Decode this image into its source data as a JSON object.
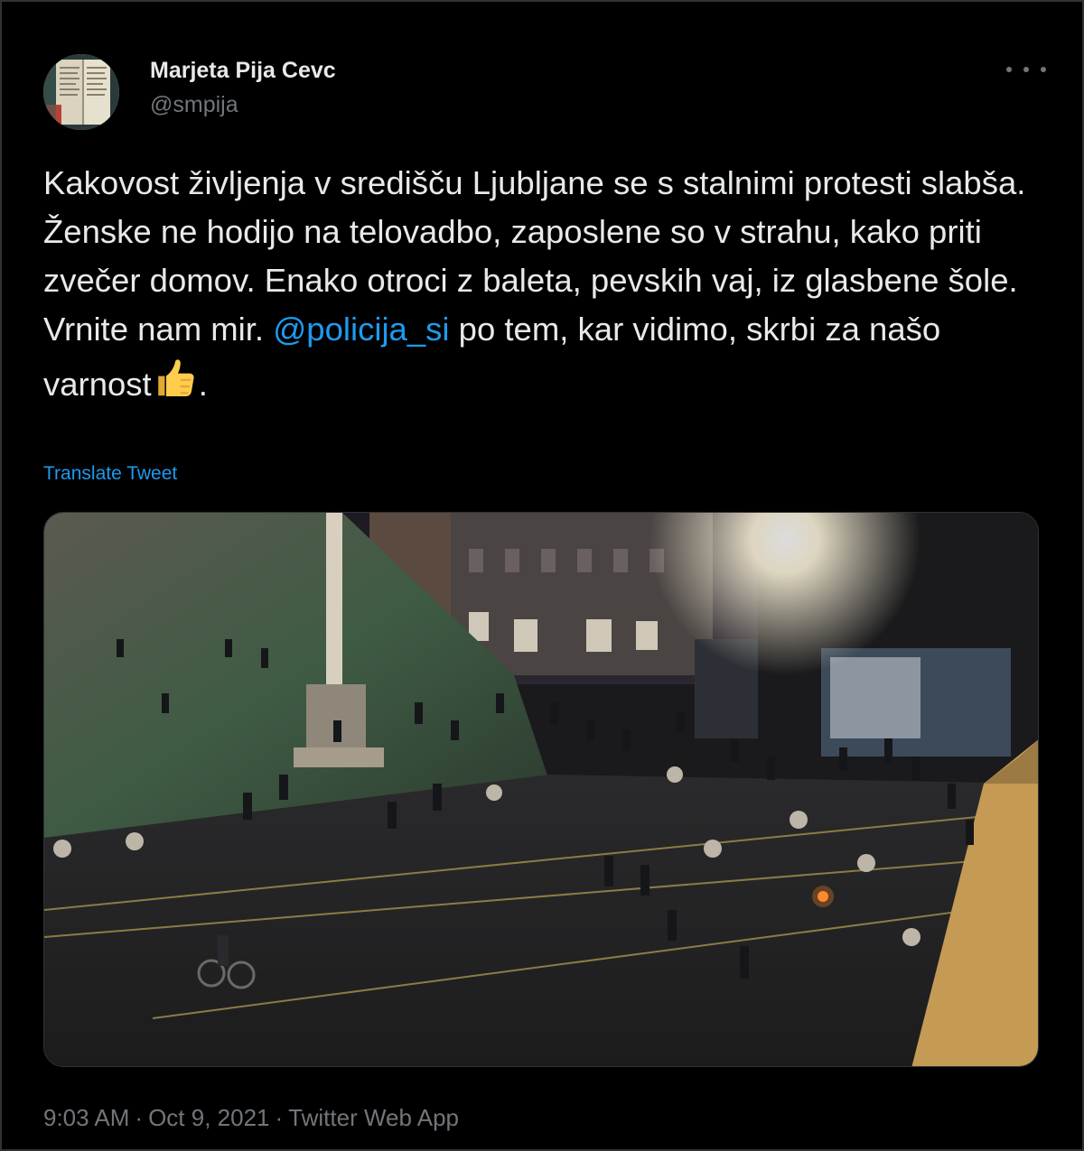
{
  "author": {
    "display_name": "Marjeta Pija Cevc",
    "handle": "@smpija"
  },
  "tweet": {
    "text_before": "Kakovost življenja v središču Ljubljane se s stalnimi protesti slabša. Ženske ne hodijo na telovadbo, zaposlene so v strahu, kako priti zvečer domov. Enako otroci z baleta, pevskih vaj, iz glasbene šole. Vrnite nam mir. ",
    "mention": "@policija_si",
    "text_after": " po tem, kar vidimo, skrbi za našo varnost",
    "emoji": "thumbs-up",
    "text_end": ".",
    "translate_label": "Translate Tweet"
  },
  "meta": {
    "time": "9:03 AM",
    "date": "Oct 9, 2021",
    "source": "Twitter Web App",
    "separator": "·"
  },
  "colors": {
    "background": "#000000",
    "text": "#e7e9ea",
    "secondary": "#71767b",
    "link": "#1d9bf0"
  },
  "icons": {
    "more": "more-dots-icon",
    "emoji": "thumbs-up-icon"
  }
}
